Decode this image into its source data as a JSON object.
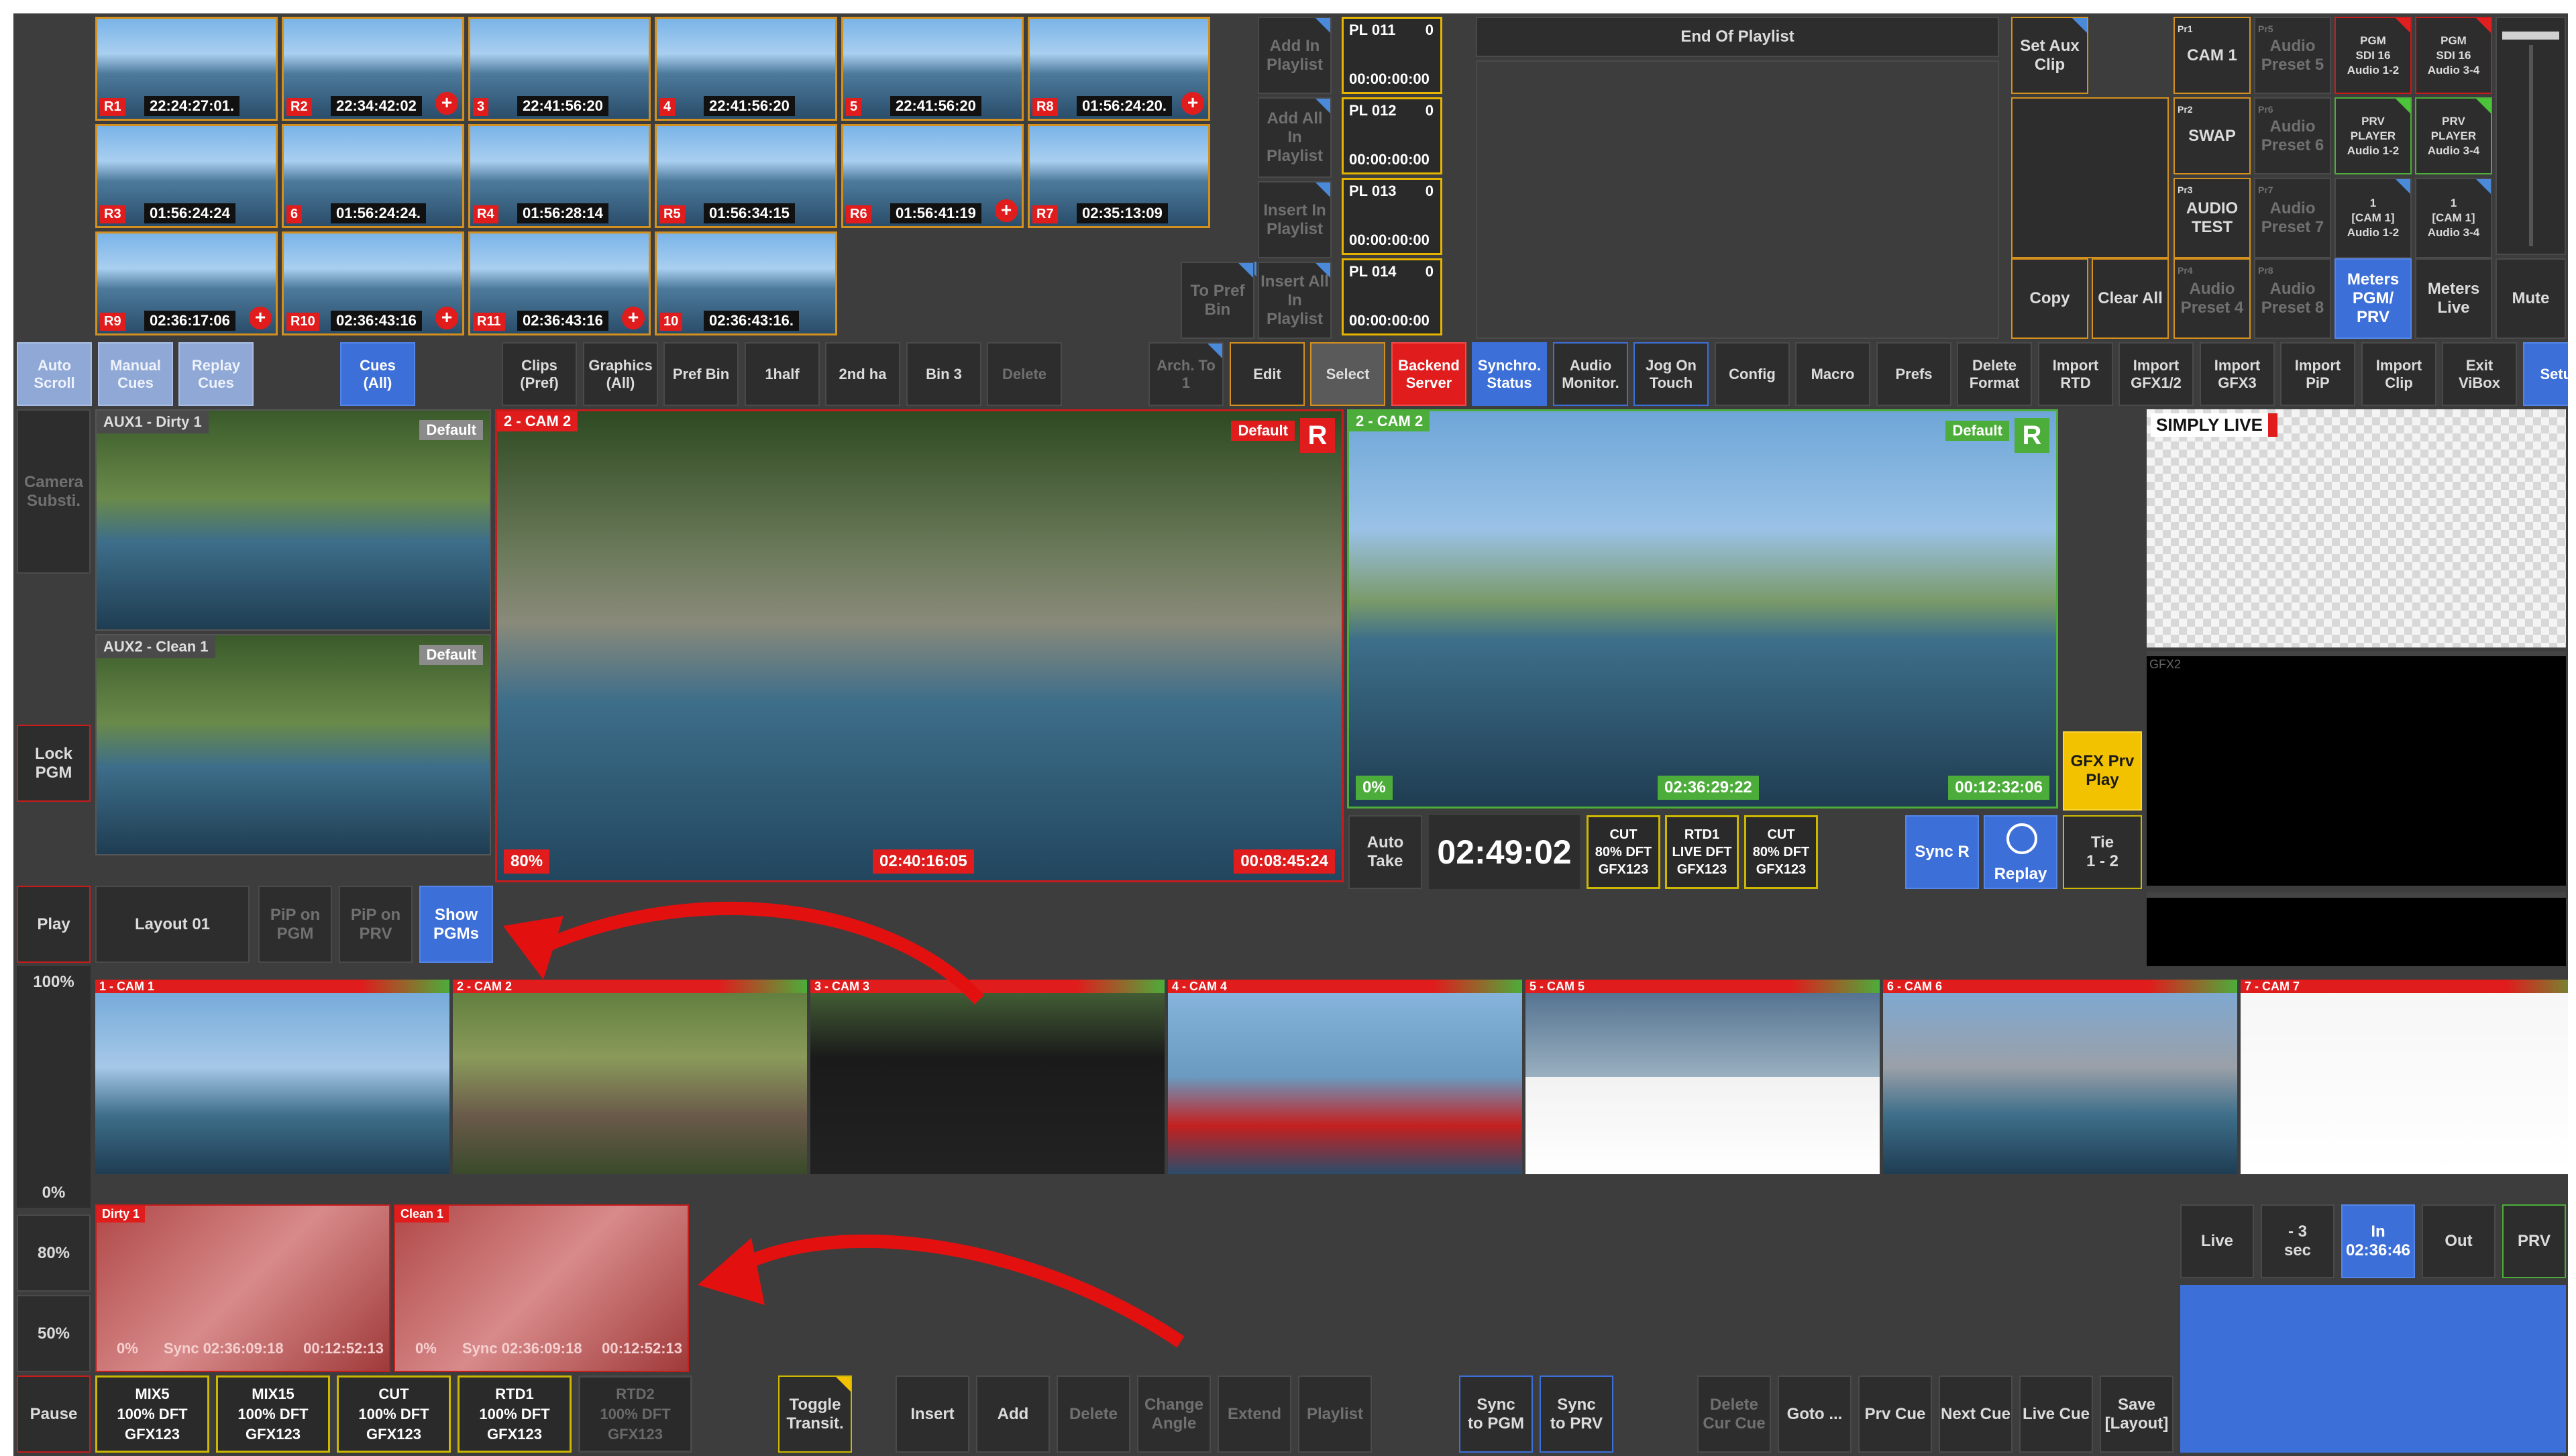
{
  "thumbs": [
    {
      "tag": "R1",
      "tc": "22:24:27:01."
    },
    {
      "tag": "R2",
      "tc": "22:34:42:02"
    },
    {
      "tag": "3",
      "tc": "22:41:56:20"
    },
    {
      "tag": "4",
      "tc": "22:41:56:20"
    },
    {
      "tag": "5",
      "tc": "22:41:56:20"
    },
    {
      "tag": "R8",
      "tc": "01:56:24:20."
    },
    {
      "tag": "R3",
      "tc": "01:56:24:24"
    },
    {
      "tag": "6",
      "tc": "01:56:24:24."
    },
    {
      "tag": "R4",
      "tc": "01:56:28:14"
    },
    {
      "tag": "R5",
      "tc": "01:56:34:15"
    },
    {
      "tag": "R6",
      "tc": "01:56:41:19"
    },
    {
      "tag": "R7",
      "tc": "02:35:13:09"
    },
    {
      "tag": "R9",
      "tc": "02:36:17:06"
    },
    {
      "tag": "R10",
      "tc": "02:36:43:16"
    },
    {
      "tag": "R11",
      "tc": "02:36:43:16"
    },
    {
      "tag": "10",
      "tc": "02:36:43:16."
    }
  ],
  "playlist_actions": {
    "add_in": "Add In\nPlaylist",
    "add_all": "Add All\nIn\nPlaylist",
    "insert_in": "Insert In\nPlaylist",
    "insert_all": "Insert All\nIn\nPlaylist",
    "to_pref": "To Pref\nBin"
  },
  "playlist_items": [
    {
      "name": "PL 011",
      "n": "0",
      "tc": "00:00:00:00"
    },
    {
      "name": "PL 012",
      "n": "0",
      "tc": "00:00:00:00"
    },
    {
      "name": "PL 013",
      "n": "0",
      "tc": "00:00:00:00"
    },
    {
      "name": "PL 014",
      "n": "0",
      "tc": "00:00:00:00"
    }
  ],
  "end_of_playlist": "End Of Playlist",
  "aux": {
    "set_aux_clip": "Set Aux\nClip",
    "copy": "Copy",
    "clear_all": "Clear All"
  },
  "presets": {
    "pr1_tag": "Pr1",
    "pr1": "CAM 1",
    "pr2_tag": "Pr2",
    "pr2": "SWAP",
    "pr3_tag": "Pr3",
    "pr3": "AUDIO\nTEST",
    "pr4_tag": "Pr4",
    "pr4": "Audio\nPreset 4",
    "pr5_tag": "Pr5",
    "pr5": "Audio\nPreset 5",
    "pr6_tag": "Pr6",
    "pr6": "Audio\nPreset 6",
    "pr7_tag": "Pr7",
    "pr7": "Audio\nPreset 7",
    "pr8_tag": "Pr8",
    "pr8": "Audio\nPreset 8"
  },
  "audio_outs": {
    "pgm12": "PGM\nSDI 16\nAudio 1-2",
    "pgm34": "PGM\nSDI 16\nAudio 3-4",
    "prv12": "PRV\nPLAYER\nAudio 1-2",
    "prv34": "PRV\nPLAYER\nAudio 3-4",
    "cam12": "1\n[CAM 1]\nAudio 1-2",
    "cam34": "1\n[CAM 1]\nAudio 3-4",
    "meters_pgm": "Meters\nPGM/\nPRV",
    "meters_live": "Meters\nLive",
    "mute": "Mute"
  },
  "toolbar": [
    "Auto\nScroll",
    "Manual\nCues",
    "Replay\nCues",
    "",
    "Cues\n(All)",
    "",
    "Clips\n(Pref)",
    "Graphics\n(All)",
    "Pref Bin",
    "1half",
    "2nd ha",
    "Bin 3",
    "Delete",
    "",
    "Arch. To\n1",
    "Edit",
    "Select",
    "Backend\nServer",
    "Synchro.\nStatus",
    "Audio\nMonitor.",
    "Jog On\nTouch",
    "Config",
    "Macro",
    "Prefs",
    "Delete\nFormat",
    "Import\nRTD",
    "Import\nGFX1/2",
    "Import\nGFX3",
    "Import\nPiP",
    "Import\nClip",
    "Exit\nViBox",
    "Setup"
  ],
  "left_side": {
    "camera_subst": "Camera\nSubsti.",
    "lock_pgm": "Lock\nPGM",
    "play": "Play",
    "p100": "100%",
    "p0": "0%",
    "p80": "80%",
    "p50": "50%",
    "pause": "Pause"
  },
  "aux_monitors": [
    {
      "label": "AUX1 - Dirty 1",
      "badge": "Default"
    },
    {
      "label": "AUX2 - Clean 1",
      "badge": "Default"
    }
  ],
  "pgm": {
    "label": "2 - CAM 2",
    "badge": "Default",
    "r": "R",
    "speed": "80%",
    "tc": "02:40:16:05",
    "remain": "00:08:45:24"
  },
  "prv": {
    "label": "2 - CAM 2",
    "badge": "Default",
    "r": "R",
    "speed": "0%",
    "tc": "02:36:29:22",
    "remain": "00:12:32:06"
  },
  "gfx": {
    "simply_live": "SIMPLY LIVE",
    "gfx2": "GFX2",
    "gfx_prv_play": "GFX Prv\nPlay"
  },
  "transport": {
    "auto_take": "Auto\nTake",
    "clock": "02:49:02",
    "cut1": [
      "CUT",
      "80% DFT",
      "GFX123"
    ],
    "rtd1": [
      "RTD1",
      "LIVE DFT",
      "GFX123"
    ],
    "cut2": [
      "CUT",
      "80% DFT",
      "GFX123"
    ],
    "sync_r": "Sync R",
    "replay": "Replay",
    "tie": "Tie\n1 - 2"
  },
  "layout_row": {
    "layout": "Layout 01",
    "pip_pgm": "PiP on\nPGM",
    "pip_prv": "PiP on\nPRV",
    "show_pgms": "Show\nPGMs"
  },
  "cams": [
    "1 - CAM 1",
    "2 - CAM 2",
    "3 - CAM 3",
    "4 - CAM 4",
    "5 - CAM 5",
    "6 - CAM 6",
    "7 - CAM 7"
  ],
  "dirty_clean": [
    {
      "label": "Dirty 1",
      "speed": "0%",
      "sync": "Sync 02:36:09:18",
      "tc": "00:12:52:13"
    },
    {
      "label": "Clean 1",
      "speed": "0%",
      "sync": "Sync 02:36:09:18",
      "tc": "00:12:52:13"
    }
  ],
  "effects": [
    [
      "MIX5",
      "100% DFT",
      "GFX123"
    ],
    [
      "MIX15",
      "100% DFT",
      "GFX123"
    ],
    [
      "CUT",
      "100% DFT",
      "GFX123"
    ],
    [
      "RTD1",
      "100% DFT",
      "GFX123"
    ],
    [
      "RTD2",
      "100% DFT",
      "GFX123"
    ]
  ],
  "bottom": {
    "toggle": "Toggle\nTransit.",
    "insert": "Insert",
    "add": "Add",
    "delete": "Delete",
    "change_angle": "Change\nAngle",
    "extend": "Extend",
    "playlist": "Playlist",
    "sync_pgm": "Sync\nto PGM",
    "sync_prv": "Sync\nto PRV",
    "delete_cue": "Delete\nCur Cue",
    "goto": "Goto ...",
    "prv_cue": "Prv Cue",
    "next_cue": "Next Cue",
    "live_cue": "Live Cue",
    "save_layout": "Save\n[Layout]"
  },
  "marks": {
    "live": "Live",
    "minus3": "- 3\nsec",
    "in": "In\n02:36:46",
    "out": "Out",
    "prv": "PRV"
  },
  "colors": {
    "accent_red": "#e01c1c",
    "accent_blue": "#3d6fd8",
    "accent_yellow": "#f2c200",
    "accent_orange": "#d4901e",
    "tally_green": "#4cad3a"
  }
}
